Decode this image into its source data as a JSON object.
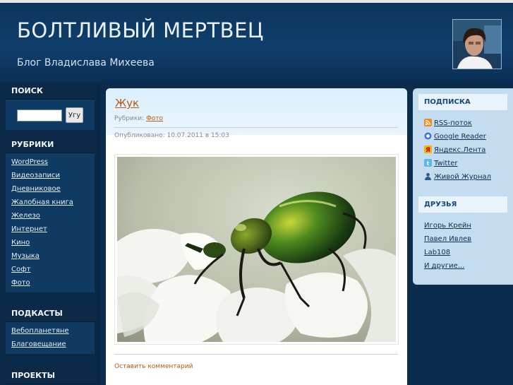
{
  "header": {
    "title": "БОЛТЛИВЫЙ МЕРТВЕЦ",
    "description": "Блог Владислава Михеева"
  },
  "left_sidebar": {
    "search": {
      "heading": "ПОИСК",
      "input_value": "",
      "button_label": "Угу"
    },
    "categories": {
      "heading": "РУБРИКИ",
      "items": [
        "WordPress",
        "Видеозаписи",
        "Дневниковое",
        "Жалобная книга",
        "Железо",
        "Интернет",
        "Кино",
        "Музыка",
        "Софт",
        "Фото"
      ]
    },
    "podcasts": {
      "heading": "ПОДКАСТЫ",
      "items": [
        "Вебопланетяне",
        "Благовещание"
      ]
    },
    "projects": {
      "heading": "ПРОЕКТЫ"
    }
  },
  "post": {
    "title": "Жук",
    "categories_label": "Рубрики:",
    "category": "Фото",
    "published": "Опубликовано: 10.07.2011 в 15:03",
    "comment_link": "Оставить комментарий"
  },
  "right_sidebar": {
    "subscribe": {
      "heading": "ПОДПИСКА",
      "items": [
        {
          "label": "RSS-поток",
          "icon": "rss-icon"
        },
        {
          "label": "Google Reader",
          "icon": "google-reader-icon"
        },
        {
          "label": "Яндекс.Лента",
          "icon": "yandex-icon"
        },
        {
          "label": "Twitter",
          "icon": "twitter-icon"
        },
        {
          "label": "Живой Журнал",
          "icon": "livejournal-icon"
        }
      ]
    },
    "friends": {
      "heading": "ДРУЗЬЯ",
      "items": [
        "Игорь Крейн",
        "Павел Ивлев",
        "Lab108",
        "И другие..."
      ]
    }
  },
  "colors": {
    "header_bg": "#0f3f6c",
    "sidebar_bg": "#0a2946",
    "link_accent": "#b75a12",
    "right_sidebar_bg": "#c3dcf0"
  }
}
